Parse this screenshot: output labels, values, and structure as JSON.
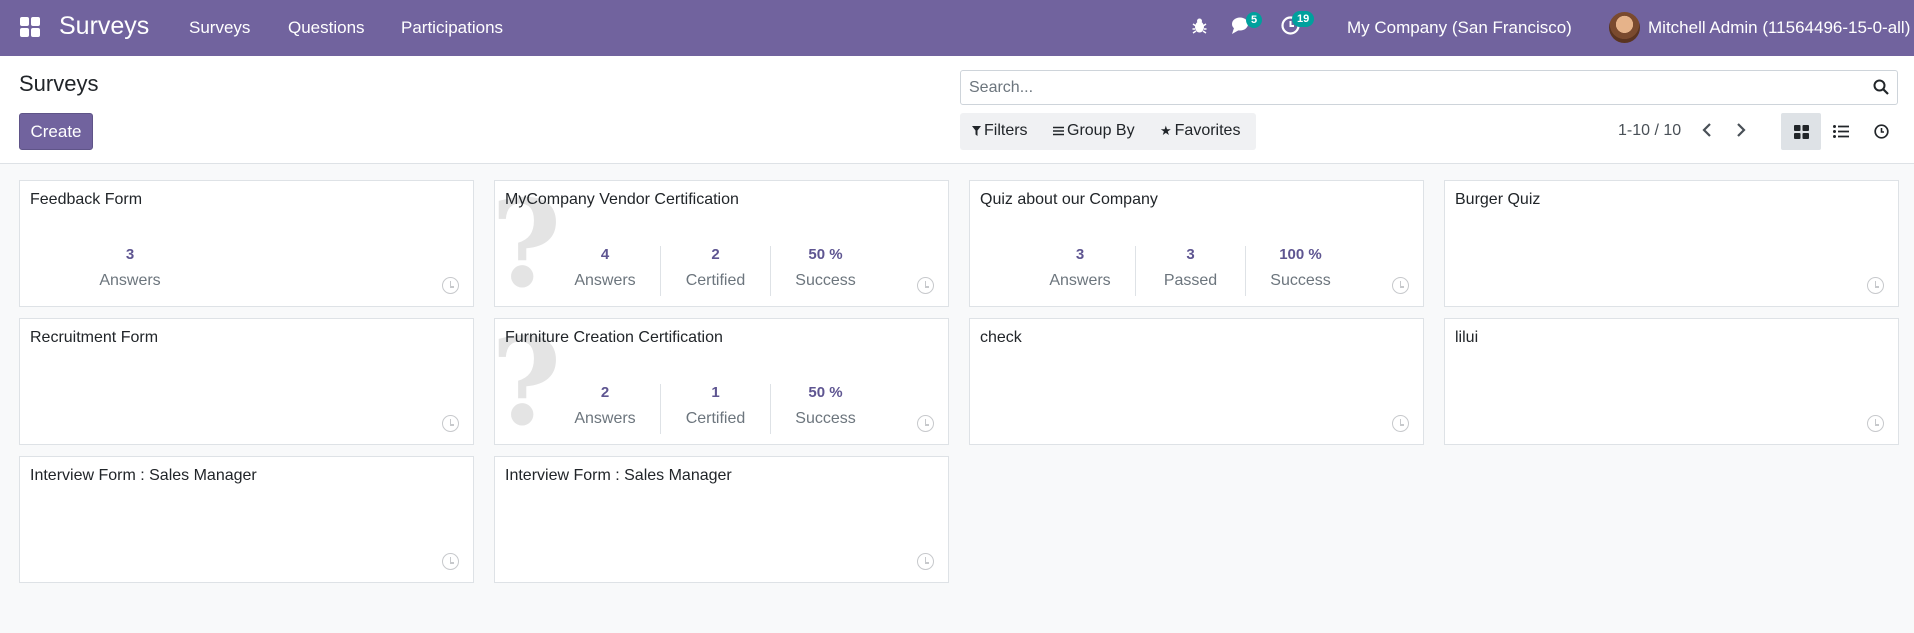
{
  "navbar": {
    "app_name": "Surveys",
    "menu": [
      "Surveys",
      "Questions",
      "Participations"
    ],
    "messages_count": "5",
    "activities_count": "19",
    "company": "My Company (San Francisco)",
    "user": "Mitchell Admin (11564496-15-0-all)"
  },
  "control": {
    "title": "Surveys",
    "create_label": "Create",
    "search_placeholder": "Search...",
    "filters_label": "Filters",
    "groupby_label": "Group By",
    "favorites_label": "Favorites",
    "pager": "1-10 / 10"
  },
  "cards": [
    {
      "title": "Feedback Form",
      "stats": [
        {
          "value": "3",
          "label": "Answers"
        }
      ]
    },
    {
      "title": "MyCompany Vendor Certification",
      "stats": [
        {
          "value": "4",
          "label": "Answers"
        },
        {
          "value": "2",
          "label": "Certified"
        },
        {
          "value": "50 %",
          "label": "Success"
        }
      ]
    },
    {
      "title": "Quiz about our Company",
      "stats": [
        {
          "value": "3",
          "label": "Answers"
        },
        {
          "value": "3",
          "label": "Passed"
        },
        {
          "value": "100 %",
          "label": "Success"
        }
      ]
    },
    {
      "title": "Burger Quiz",
      "stats": []
    },
    {
      "title": "Recruitment Form",
      "stats": []
    },
    {
      "title": "Furniture Creation Certification",
      "stats": [
        {
          "value": "2",
          "label": "Answers"
        },
        {
          "value": "1",
          "label": "Certified"
        },
        {
          "value": "50 %",
          "label": "Success"
        }
      ]
    },
    {
      "title": "check",
      "stats": []
    },
    {
      "title": "lilui",
      "stats": []
    },
    {
      "title": "Interview Form : Sales Manager",
      "stats": []
    },
    {
      "title": "Interview Form : Sales Manager",
      "stats": []
    }
  ],
  "colors": {
    "brand": "#71639e",
    "badge": "#00a09d",
    "stat_value": "#5e5591"
  },
  "icons": {
    "apps": "grid-icon",
    "debug": "bug-icon",
    "messages": "chat-icon",
    "activities": "clock-icon",
    "search": "search-icon"
  }
}
